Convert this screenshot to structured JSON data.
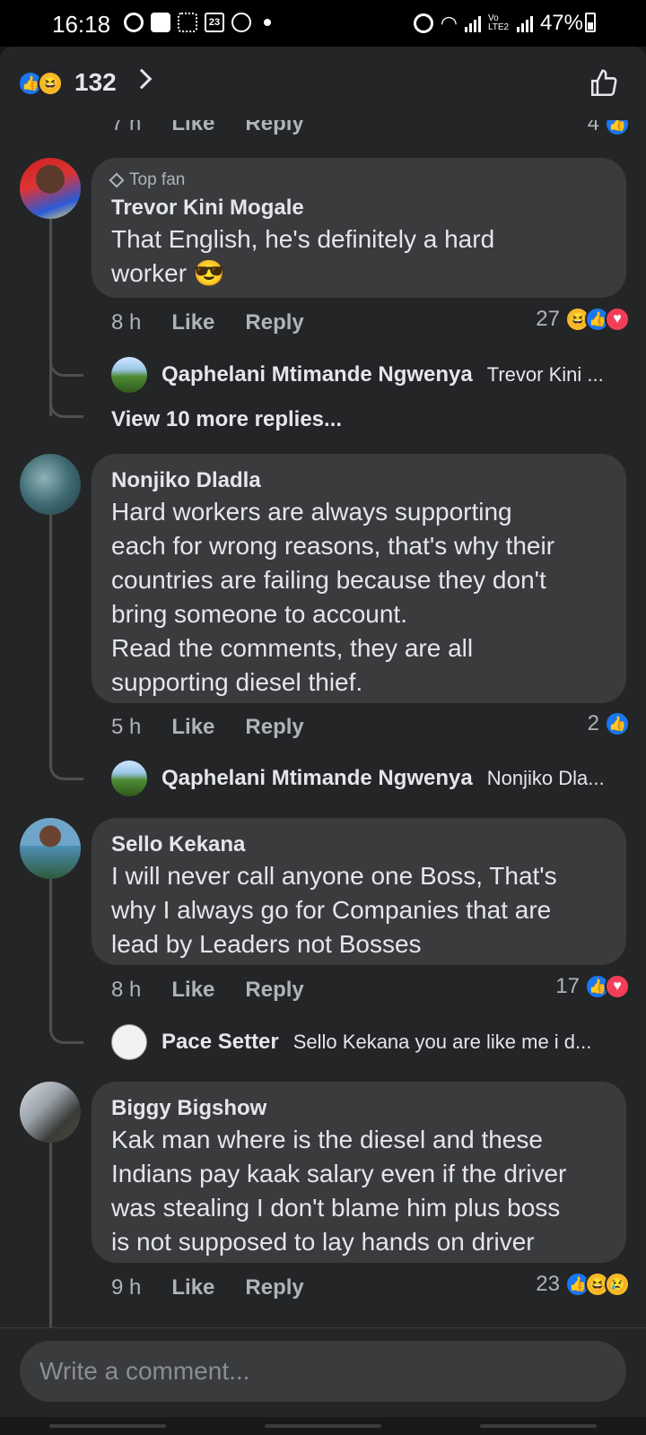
{
  "status_bar": {
    "time": "16:18",
    "calendar_day": "23",
    "network": "Vo LTE2",
    "battery": "47%"
  },
  "header": {
    "reaction_count": "132",
    "reaction_icons": [
      "like-icon",
      "haha-icon"
    ]
  },
  "partial_row": {
    "time": "7 h",
    "like_label": "Like",
    "reply_label": "Reply",
    "reaction_count": "4"
  },
  "comments": [
    {
      "badge": "Top fan",
      "author": "Trevor Kini Mogale",
      "text_lines": [
        "That English, he's definitely a hard",
        "worker 😎"
      ],
      "time": "8 h",
      "like_label": "Like",
      "reply_label": "Reply",
      "reaction_count": "27",
      "reactions": [
        "haha-icon",
        "like-icon",
        "love-icon"
      ],
      "reply_preview": {
        "author": "Qaphelani Mtimande Ngwenya",
        "text": "Trevor Kini ..."
      },
      "view_more": "View 10 more replies..."
    },
    {
      "author": "Nonjiko Dladla",
      "text_lines": [
        "Hard workers are always supporting",
        "each for wrong reasons, that's why their",
        "countries are failing because they don't",
        "bring someone to account.",
        "Read the comments, they are all",
        "supporting  diesel thief."
      ],
      "time": "5 h",
      "like_label": "Like",
      "reply_label": "Reply",
      "reaction_count": "2",
      "reactions": [
        "like-icon"
      ],
      "reply_preview": {
        "author": "Qaphelani Mtimande Ngwenya",
        "text": "Nonjiko Dla..."
      }
    },
    {
      "author": "Sello Kekana",
      "text_lines": [
        "I will never call anyone one Boss, That's",
        "why I always go for Companies that are",
        "lead by Leaders not Bosses"
      ],
      "time": "8 h",
      "like_label": "Like",
      "reply_label": "Reply",
      "reaction_count": "17",
      "reactions": [
        "like-icon",
        "love-icon"
      ],
      "reply_preview": {
        "author": "Pace Setter",
        "text": "Sello Kekana you are like me i d..."
      }
    },
    {
      "author": "Biggy Bigshow",
      "text_lines": [
        "Kak man where is the diesel and these",
        "Indians pay kaak salary even if the driver",
        "was stealing I don't blame him plus boss",
        "is not supposed to lay hands on driver"
      ],
      "time": "9 h",
      "like_label": "Like",
      "reply_label": "Reply",
      "reaction_count": "23",
      "reactions": [
        "like-icon",
        "haha-icon",
        "sad-icon"
      ]
    }
  ],
  "composer": {
    "placeholder": "Write a comment..."
  },
  "colors": {
    "background": "#242526",
    "bubble": "#3a3b3c",
    "like_blue": "#1877f2",
    "love_red": "#f33e58",
    "haha_yellow": "#f7b928"
  }
}
